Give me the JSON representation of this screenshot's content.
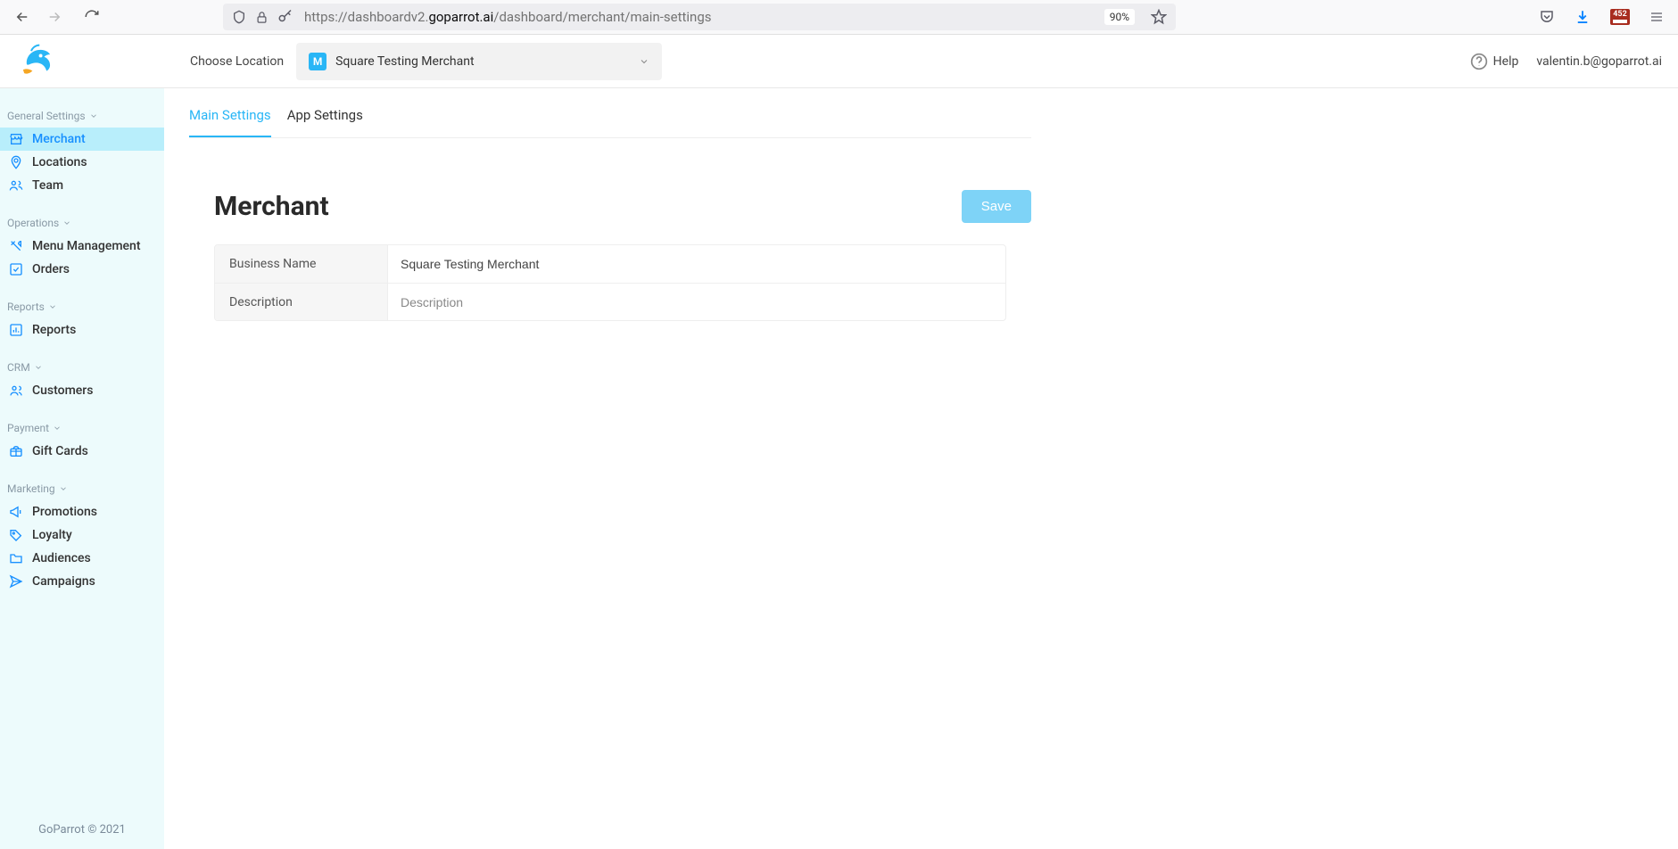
{
  "browser": {
    "url_prefix": "https://dashboardv2.",
    "url_domain": "goparrot.ai",
    "url_path": "/dashboard/merchant/main-settings",
    "zoom": "90%",
    "ext_badge": "452"
  },
  "header": {
    "choose_location_label": "Choose Location",
    "selected_location_badge": "M",
    "selected_location": "Square Testing Merchant",
    "help_label": "Help",
    "user_email": "valentin.b@goparrot.ai"
  },
  "sidebar": {
    "sections": [
      {
        "label": "General Settings",
        "items": [
          {
            "label": "Merchant",
            "icon": "store-icon",
            "active": true
          },
          {
            "label": "Locations",
            "icon": "location-icon"
          },
          {
            "label": "Team",
            "icon": "team-icon"
          }
        ]
      },
      {
        "label": "Operations",
        "items": [
          {
            "label": "Menu Management",
            "icon": "utensils-icon"
          },
          {
            "label": "Orders",
            "icon": "check-square-icon"
          }
        ]
      },
      {
        "label": "Reports",
        "items": [
          {
            "label": "Reports",
            "icon": "bar-chart-icon"
          }
        ]
      },
      {
        "label": "CRM",
        "items": [
          {
            "label": "Customers",
            "icon": "customers-icon"
          }
        ]
      },
      {
        "label": "Payment",
        "items": [
          {
            "label": "Gift Cards",
            "icon": "gift-card-icon"
          }
        ]
      },
      {
        "label": "Marketing",
        "items": [
          {
            "label": "Promotions",
            "icon": "megaphone-icon"
          },
          {
            "label": "Loyalty",
            "icon": "tag-icon"
          },
          {
            "label": "Audiences",
            "icon": "folder-icon"
          },
          {
            "label": "Campaigns",
            "icon": "send-icon"
          }
        ]
      }
    ],
    "footer": "GoParrot © 2021"
  },
  "main": {
    "tabs": [
      {
        "label": "Main Settings",
        "active": true
      },
      {
        "label": "App Settings"
      }
    ],
    "page_title": "Merchant",
    "save_label": "Save",
    "form": {
      "rows": [
        {
          "label": "Business Name",
          "value": "Square Testing Merchant",
          "placeholder": ""
        },
        {
          "label": "Description",
          "value": "",
          "placeholder": "Description"
        }
      ]
    }
  },
  "colors": {
    "accent": "#29b6f6",
    "sidebar_bg": "#edfbfc",
    "active_nav_bg": "#b8eefb"
  }
}
